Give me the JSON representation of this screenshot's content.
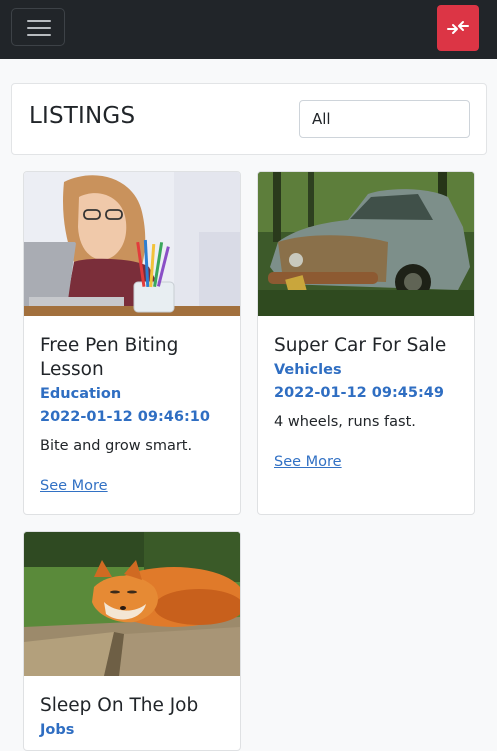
{
  "navbar": {
    "menu_icon": "hamburger-menu-icon",
    "logout_icon": "compress-arrows-icon",
    "accent_color": "#dc3545"
  },
  "header": {
    "title": "LISTINGS",
    "filter": {
      "selected": "All"
    }
  },
  "listings": [
    {
      "title": "Free Pen Biting Lesson",
      "category": "Education",
      "date": "2022-01-12 09:46:10",
      "description": "Bite and grow smart.",
      "link_label": "See More",
      "image": "woman-biting-pen-photo"
    },
    {
      "title": "Super Car For Sale",
      "category": "Vehicles",
      "date": "2022-01-12 09:45:49",
      "description": "4 wheels, runs fast.",
      "link_label": "See More",
      "image": "rusty-old-car-photo"
    },
    {
      "title": "Sleep On The Job",
      "category": "Jobs",
      "image": "sleeping-fox-photo"
    }
  ]
}
